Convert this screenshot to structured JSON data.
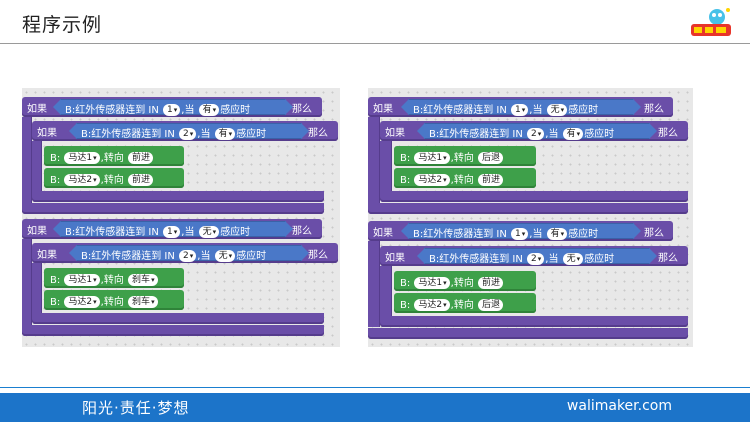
{
  "header": {
    "title": "程序示例"
  },
  "footer": {
    "slogan": "阳光·责任·梦想",
    "site": "walimaker.com"
  },
  "labels": {
    "if": "如果",
    "then": "那么",
    "b_ir": "B:红外传感器连到 IN",
    "when": ",当",
    "sense": "感应时",
    "b": "B:",
    "turn": ",转向"
  },
  "panels": [
    {
      "groups": [
        {
          "outer": {
            "port": "1",
            "state": "有"
          },
          "inner": {
            "port": "2",
            "state": "有"
          },
          "motors": [
            {
              "motor": "马达1",
              "dir": "前进"
            },
            {
              "motor": "马达2",
              "dir": "前进"
            }
          ]
        },
        {
          "outer": {
            "port": "1",
            "state": "无"
          },
          "inner": {
            "port": "2",
            "state": "无"
          },
          "motors": [
            {
              "motor": "马达1",
              "dir": "刹车"
            },
            {
              "motor": "马达2",
              "dir": "刹车"
            }
          ]
        }
      ]
    },
    {
      "groups": [
        {
          "outer": {
            "port": "1",
            "state": "无"
          },
          "inner": {
            "port": "2",
            "state": "有"
          },
          "motors": [
            {
              "motor": "马达1",
              "dir": "后退"
            },
            {
              "motor": "马达2",
              "dir": "前进"
            }
          ]
        },
        {
          "outer": {
            "port": "1",
            "state": "有"
          },
          "inner": {
            "port": "2",
            "state": "无"
          },
          "motors": [
            {
              "motor": "马达1",
              "dir": "前进"
            },
            {
              "motor": "马达2",
              "dir": "后退"
            }
          ]
        }
      ]
    }
  ]
}
